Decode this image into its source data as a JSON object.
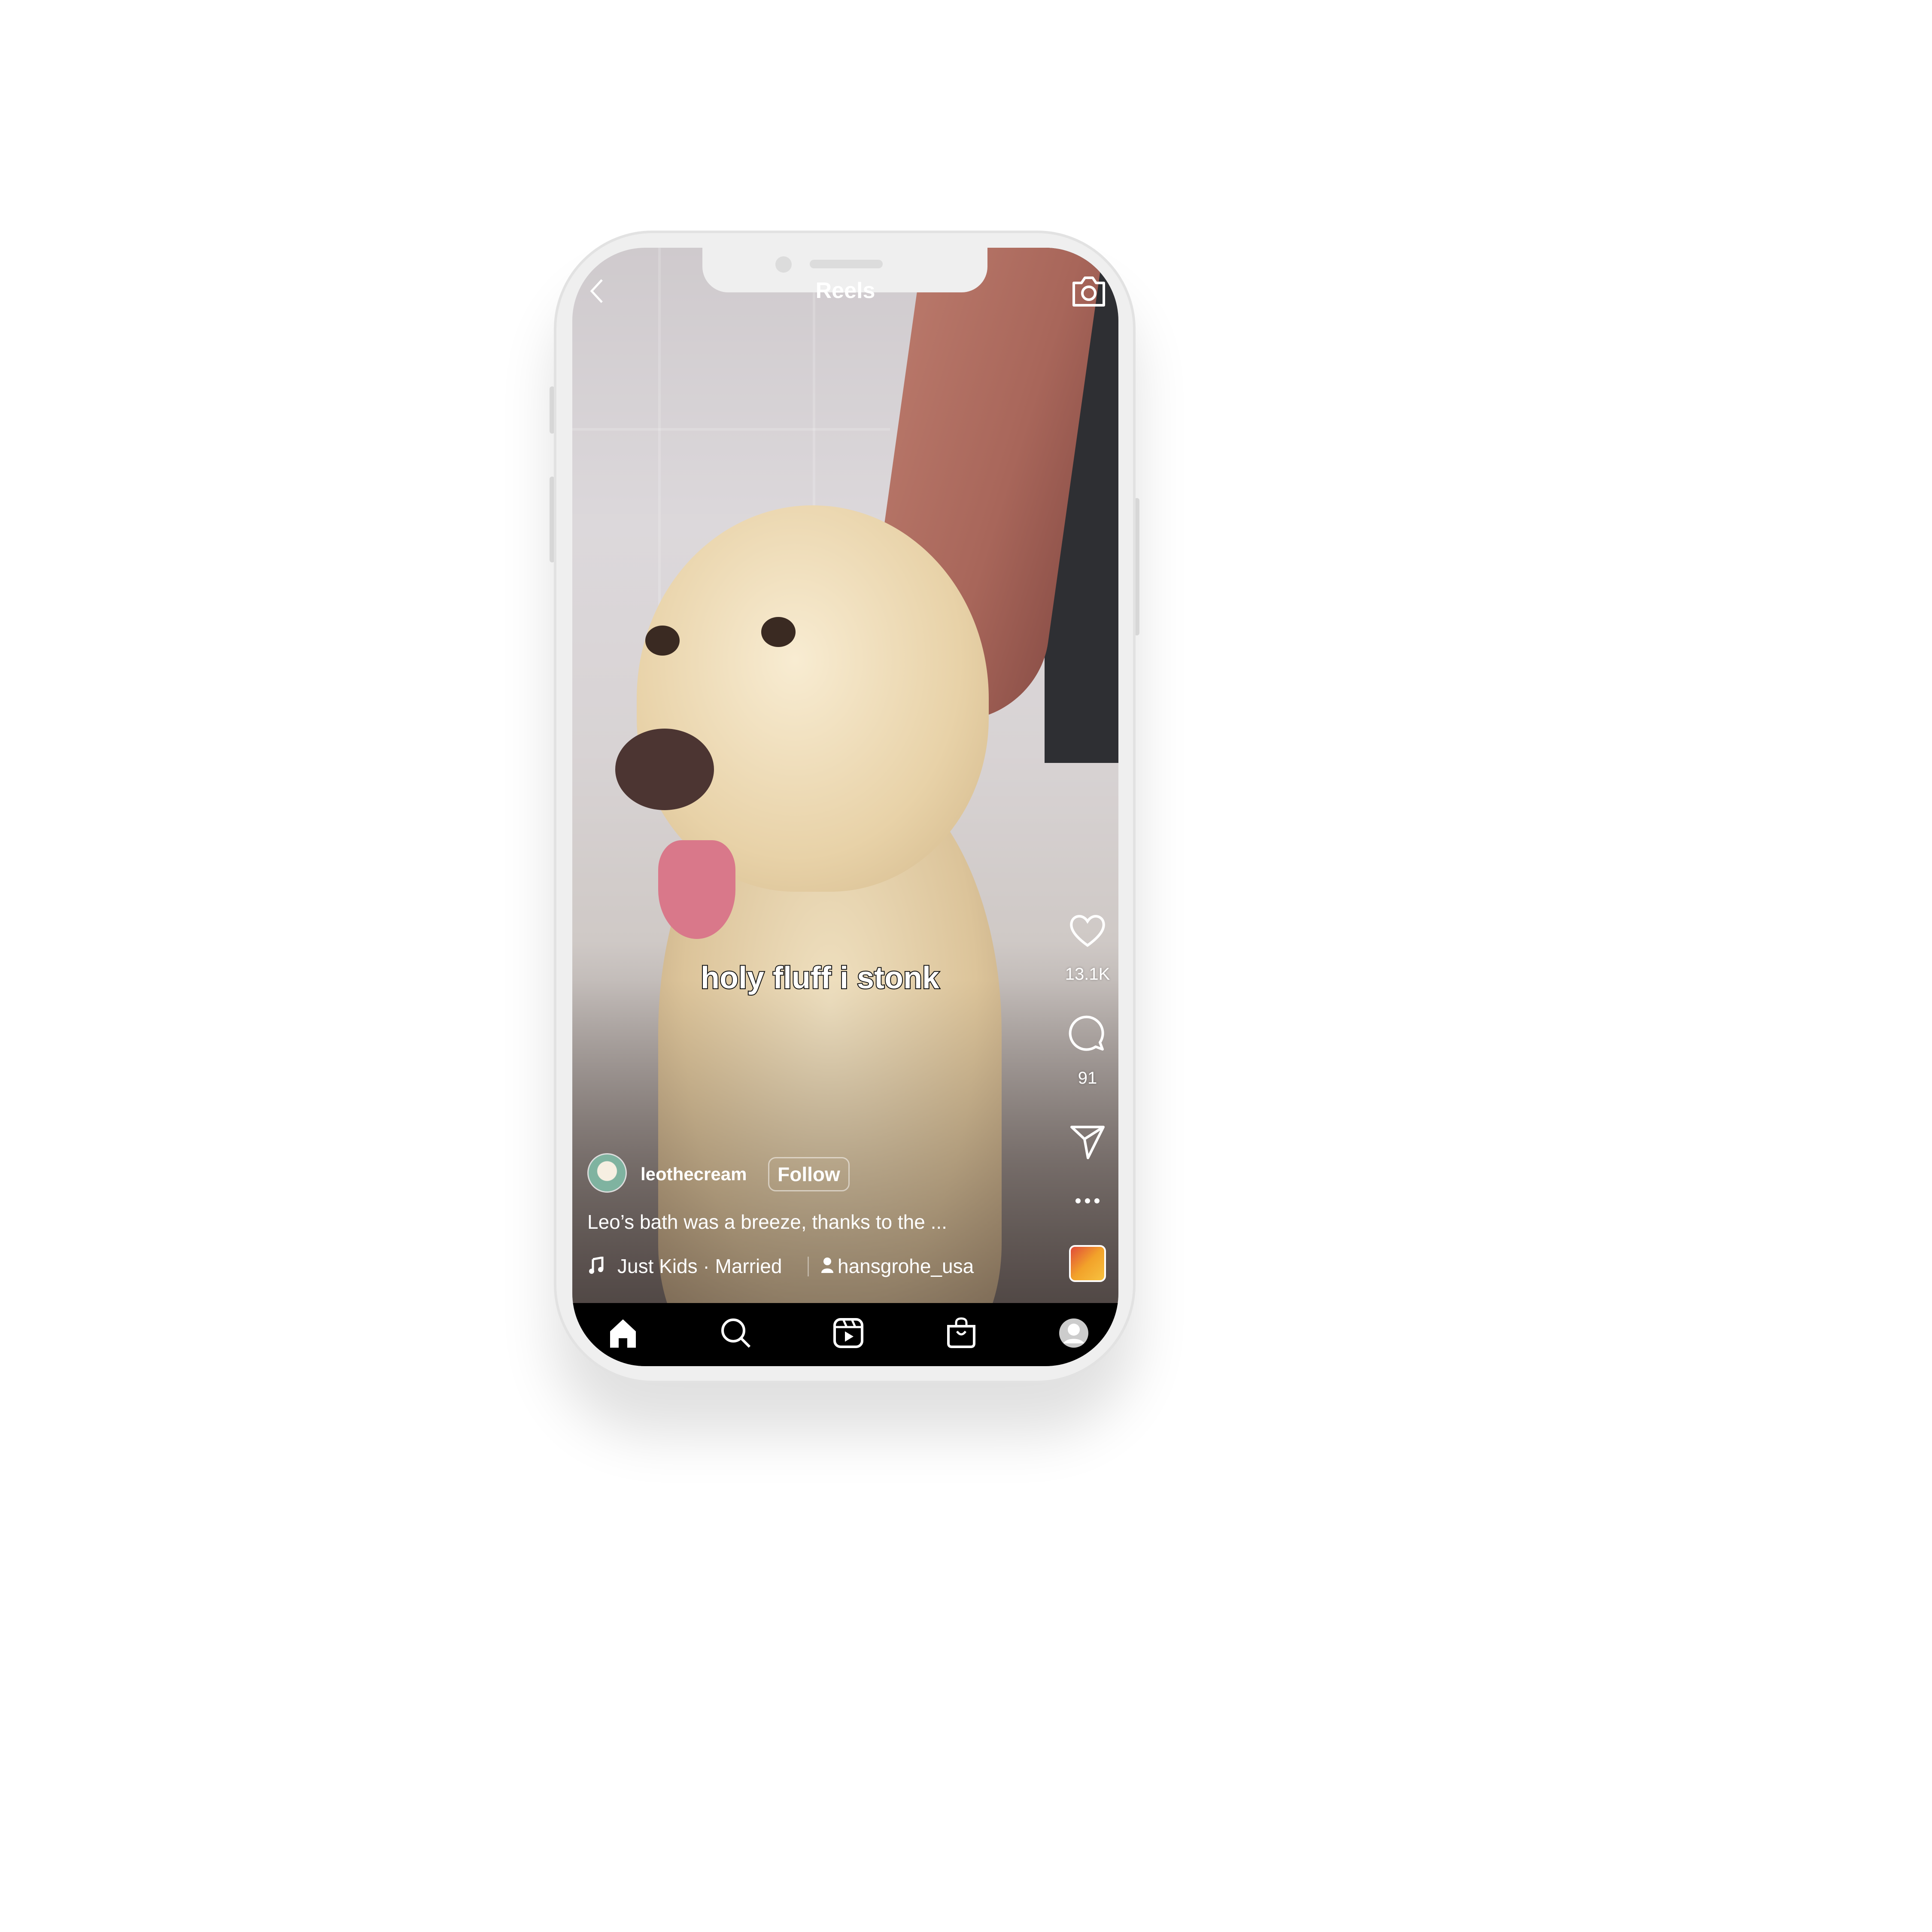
{
  "header": {
    "title": "Reels",
    "back_icon": "chevron-left-icon",
    "camera_icon": "camera-icon"
  },
  "video": {
    "subtitle": "holy fluff i stonk"
  },
  "actions": {
    "likes": "13.1K",
    "comments": "91"
  },
  "post": {
    "username": "leothecream",
    "follow_label": "Follow",
    "caption": "Leo’s bath was a breeze, thanks to the ...",
    "audio": "Just Kids · Married",
    "tagged_user": "hansgrohe_usa"
  },
  "nav": {
    "items": [
      "home-icon",
      "search-icon",
      "reels-icon",
      "shop-icon",
      "profile-icon"
    ]
  },
  "colors": {
    "nav_bg": "#000000",
    "frame": "#efefef"
  }
}
